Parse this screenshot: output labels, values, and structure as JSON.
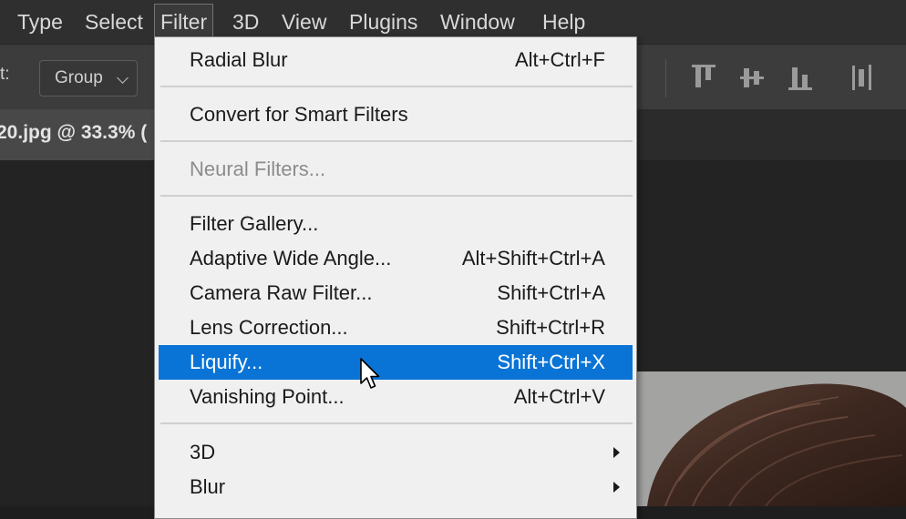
{
  "menubar": {
    "items": [
      {
        "label": "Type"
      },
      {
        "label": "Select"
      },
      {
        "label": "Filter"
      },
      {
        "label": "3D"
      },
      {
        "label": "View"
      },
      {
        "label": "Plugins"
      },
      {
        "label": "Window"
      },
      {
        "label": "Help"
      }
    ]
  },
  "options": {
    "label": "t:",
    "select_value": "Group"
  },
  "document": {
    "tab_title": "20.jpg @ 33.3% ("
  },
  "filter_menu": {
    "items": [
      {
        "label": "Radial Blur",
        "shortcut": "Alt+Ctrl+F"
      },
      {
        "label": "Convert for Smart Filters",
        "shortcut": ""
      },
      {
        "label": "Neural Filters...",
        "shortcut": "",
        "disabled": true
      },
      {
        "label": "Filter Gallery...",
        "shortcut": ""
      },
      {
        "label": "Adaptive Wide Angle...",
        "shortcut": "Alt+Shift+Ctrl+A"
      },
      {
        "label": "Camera Raw Filter...",
        "shortcut": "Shift+Ctrl+A"
      },
      {
        "label": "Lens Correction...",
        "shortcut": "Shift+Ctrl+R"
      },
      {
        "label": "Liquify...",
        "shortcut": "Shift+Ctrl+X",
        "highlighted": true
      },
      {
        "label": "Vanishing Point...",
        "shortcut": "Alt+Ctrl+V"
      },
      {
        "label": "3D",
        "shortcut": "",
        "submenu": true
      },
      {
        "label": "Blur",
        "shortcut": "",
        "submenu": true
      }
    ]
  },
  "colors": {
    "menu_highlight": "#0a74d6",
    "menu_background": "#f0f0f0",
    "menubar_background": "#2f2f2f",
    "options_background": "#3c3c3c"
  }
}
